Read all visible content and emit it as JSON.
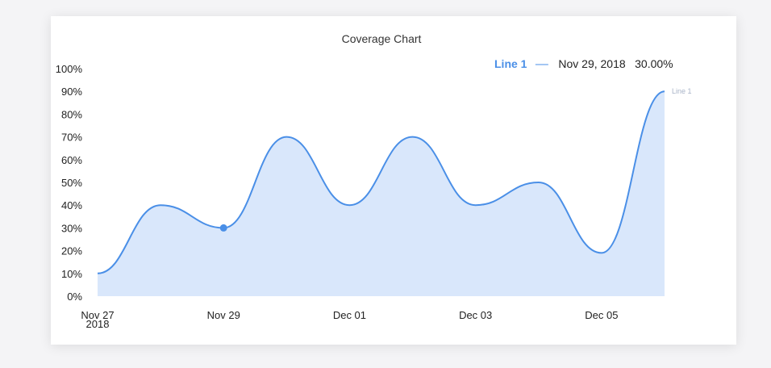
{
  "chart_data": {
    "type": "area",
    "title": "Coverage Chart",
    "xlabel": "",
    "ylabel": "",
    "x": [
      "Nov 27",
      "Nov 28",
      "Nov 29",
      "Nov 30",
      "Dec 01",
      "Dec 02",
      "Dec 03",
      "Dec 04",
      "Dec 05",
      "Dec 06"
    ],
    "x_tick_labels": [
      {
        "index": 0,
        "label": "Nov 27",
        "sublabel": "2018"
      },
      {
        "index": 2,
        "label": "Nov 29"
      },
      {
        "index": 4,
        "label": "Dec 01"
      },
      {
        "index": 6,
        "label": "Dec 03"
      },
      {
        "index": 8,
        "label": "Dec 05"
      }
    ],
    "y_tick_labels": [
      "0%",
      "10%",
      "20%",
      "30%",
      "40%",
      "50%",
      "60%",
      "70%",
      "80%",
      "90%",
      "100%"
    ],
    "ylim": [
      0,
      100
    ],
    "series": [
      {
        "name": "Line 1",
        "values": [
          10,
          40,
          30,
          70,
          40,
          70,
          40,
          50,
          19,
          90
        ]
      }
    ],
    "legend": {
      "name": "Line 1",
      "separator": "—",
      "date": "Nov 29, 2018",
      "value": "30.00%",
      "placement": "top-right"
    },
    "highlight_index": 2,
    "end_label": "Line 1",
    "grid": false,
    "colors": {
      "line": "#4a8fe7",
      "fill": "#d9e7fb",
      "legend": "#4a8fe7"
    }
  }
}
